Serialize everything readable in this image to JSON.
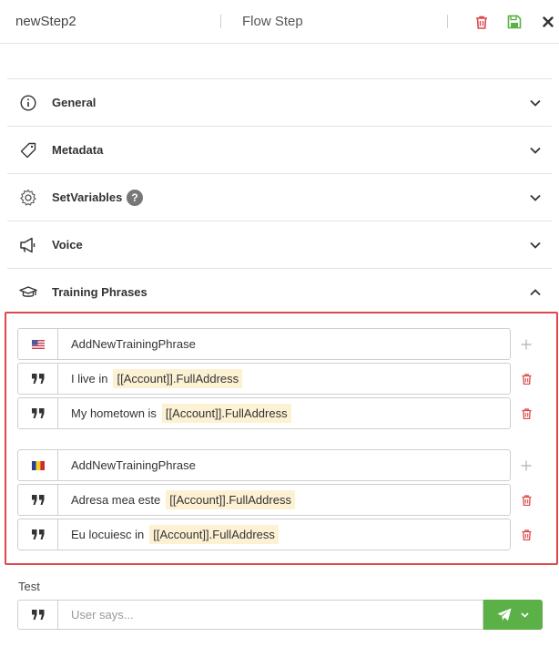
{
  "header": {
    "step_name": "newStep2",
    "step_type": "Flow Step",
    "delete_icon": "trash-icon",
    "save_icon": "save-icon",
    "close_icon": "close-icon"
  },
  "sections": [
    {
      "title": "General",
      "icon": "info-icon",
      "expanded": false
    },
    {
      "title": "Metadata",
      "icon": "tag-icon",
      "expanded": false
    },
    {
      "title": "SetVariables",
      "icon": "gear-icon",
      "expanded": false,
      "help_badge": "?"
    },
    {
      "title": "Voice",
      "icon": "megaphone-icon",
      "expanded": false
    },
    {
      "title": "Training Phrases",
      "icon": "graduation-cap-icon",
      "expanded": true
    }
  ],
  "training_phrases": {
    "groups": [
      {
        "language_flag": "us-flag-icon",
        "add_label": "AddNewTrainingPhrase",
        "phrases": [
          {
            "text": "I live in",
            "entity": "[[Account]].FullAddress"
          },
          {
            "text": "My hometown is",
            "entity": "[[Account]].FullAddress"
          }
        ]
      },
      {
        "language_flag": "ro-flag-icon",
        "add_label": "AddNewTrainingPhrase",
        "phrases": [
          {
            "text": "Adresa mea este",
            "entity": "[[Account]].FullAddress"
          },
          {
            "text": "Eu locuiesc in",
            "entity": "[[Account]].FullAddress"
          }
        ]
      }
    ]
  },
  "test": {
    "label": "Test",
    "placeholder": "User says...",
    "value": ""
  },
  "colors": {
    "danger": "#e0474c",
    "success": "#5cb048",
    "entity_bg": "#fdf1d4",
    "border": "#cfcfcf"
  }
}
